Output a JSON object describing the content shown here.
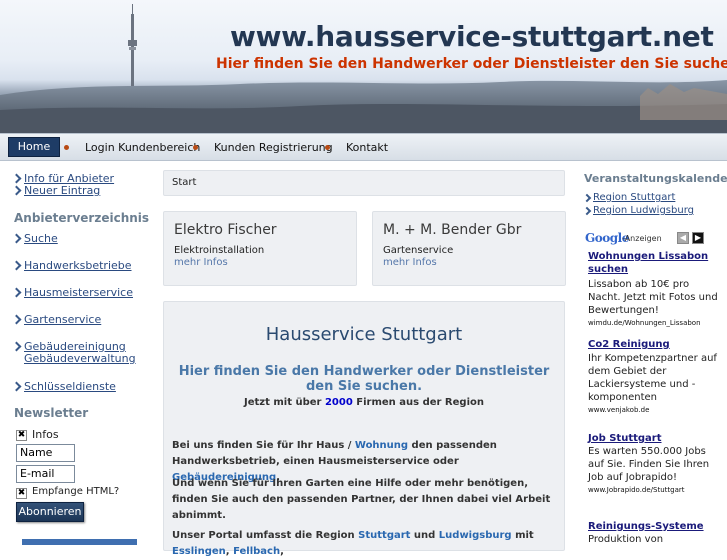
{
  "header": {
    "title": "www.hausservice-stuttgart.net",
    "subtitle": "Hier finden Sie den Handwerker oder Dienstleister den Sie suchen"
  },
  "nav": {
    "items": [
      "Home",
      "Login Kundenbereich",
      "Kunden Registrierung",
      "Kontakt"
    ]
  },
  "sidebar": {
    "top_links": [
      "Info für Anbieter",
      "Neuer Eintrag"
    ],
    "directory_heading": "Anbieterverzeichnis",
    "directory_links": [
      "Suche",
      "Handwerksbetriebe",
      "Hausmeisterservice",
      "Gartenservice",
      "Gebäudereinigung",
      "Gebäudeverwaltung",
      "Schlüsseldienste"
    ],
    "newsletter_heading": "Newsletter",
    "infos_label": "Infos",
    "name_value": "Name",
    "email_value": "E-mail",
    "html_label": "Empfange HTML?",
    "subscribe_label": "Abonnieren"
  },
  "main": {
    "breadcrumb": "Start",
    "cards": [
      {
        "title": "Elektro Fischer",
        "category": "Elektroinstallation",
        "more": "mehr Infos"
      },
      {
        "title": "M. + M. Bender Gbr",
        "category": "Gartenservice",
        "more": "mehr Infos"
      }
    ],
    "heading": "Hausservice Stuttgart",
    "subheading": "Hier finden Sie den Handwerker oder Dienstleister den Sie suchen.",
    "count_prefix": "Jetzt mit über ",
    "count_value": "2000",
    "count_suffix": " Firmen aus der Region",
    "p1_a": "Bei uns finden Sie für Ihr Haus / ",
    "p1_link1": "Wohnung",
    "p1_b": " den passenden Handwerksbetrieb, einen Hausmeisterservice oder ",
    "p1_link2": "Gebäudereinigung",
    "p1_c": ".",
    "p2": "Und wenn Sie für Ihren Garten eine Hilfe oder mehr benötigen, finden Sie auch den passenden Partner, der Ihnen dabei viel Arbeit abnimmt.",
    "p3_a": "Unser Portal umfasst die Region ",
    "p3_link1": "Stuttgart",
    "p3_b": " und ",
    "p3_link2": "Ludwigsburg",
    "p3_c": " mit ",
    "p3_link3": "Esslingen",
    "p3_d": ", ",
    "p3_link4": "Fellbach",
    "p3_e": ","
  },
  "right": {
    "events_heading": "Veranstaltungskalender",
    "event_links": [
      "Region Stuttgart",
      "Region Ludwigsburg"
    ],
    "google": "Google",
    "ads_label": "-Anzeigen",
    "ads": [
      {
        "title": "Wohnungen Lissabon suchen",
        "text": "Lissabon ab 10€ pro Nacht. Jetzt mit Fotos und Bewertungen!",
        "url": "wimdu.de/Wohnungen_Lissabon"
      },
      {
        "title": "Co2 Reinigung",
        "text": "Ihr Kompetenzpartner auf dem Gebiet der Lackiersysteme und -komponenten",
        "url": "www.venjakob.de"
      },
      {
        "title": "Job Stuttgart",
        "text": "Es warten 550.000 Jobs auf Sie. Finden Sie Ihren Job auf Jobrapido!",
        "url": "www.Jobrapido.de/Stuttgart"
      },
      {
        "title": "Reinigungs-Systeme",
        "text": "Produktion von",
        "url": ""
      }
    ]
  },
  "colors": {
    "brand": "#233752",
    "accent": "#cc3300",
    "nav_active": "#1e3c66"
  }
}
